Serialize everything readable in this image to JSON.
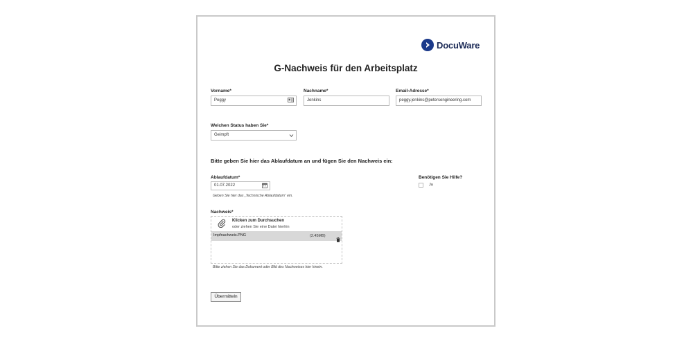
{
  "brand": {
    "name": "DocuWare",
    "color": "#1b3a8a"
  },
  "form": {
    "title": "G-Nachweis für den Arbeitsplatz",
    "vorname": {
      "label": "Vorname*",
      "value": "Peggy"
    },
    "nachname": {
      "label": "Nachname*",
      "value": "Jenkins"
    },
    "email": {
      "label": "Email-Adresse*",
      "value": "peggy.jenkins@petersengineering.com"
    },
    "status": {
      "label": "Welchen Status haben Sie*",
      "value": "Geimpft"
    },
    "section_heading": "Bitte geben Sie hier das Ablaufdatum an und fügen Sie den Nachweis ein:",
    "ablaufdatum": {
      "label": "Ablaufdatum*",
      "value": "01.07.2022",
      "hint": "Geben Sie hier das „Technische Ablaufdatum“ ein."
    },
    "hilfe": {
      "label": "Benötigen Sie Hilfe?",
      "option": "Ja",
      "checked": false
    },
    "nachweis": {
      "label": "Nachweis*",
      "browse_label": "Klicken zum Durchsuchen",
      "drag_label": "oder ziehen Sie eine Datei hierhin",
      "file_name": "Impfnachweis.PNG",
      "file_size": "(2.45MB)",
      "hint": "Bitte ziehen Sie das Dokument oder Bild des Nachweises hier hinein."
    },
    "submit_label": "Übermitteln"
  },
  "icons": {
    "vorname_field": "contact-card-icon",
    "status_field": "chevron-down-icon",
    "date_field": "calendar-icon",
    "upload": "paperclip-icon",
    "file_remove": "trash-icon"
  }
}
